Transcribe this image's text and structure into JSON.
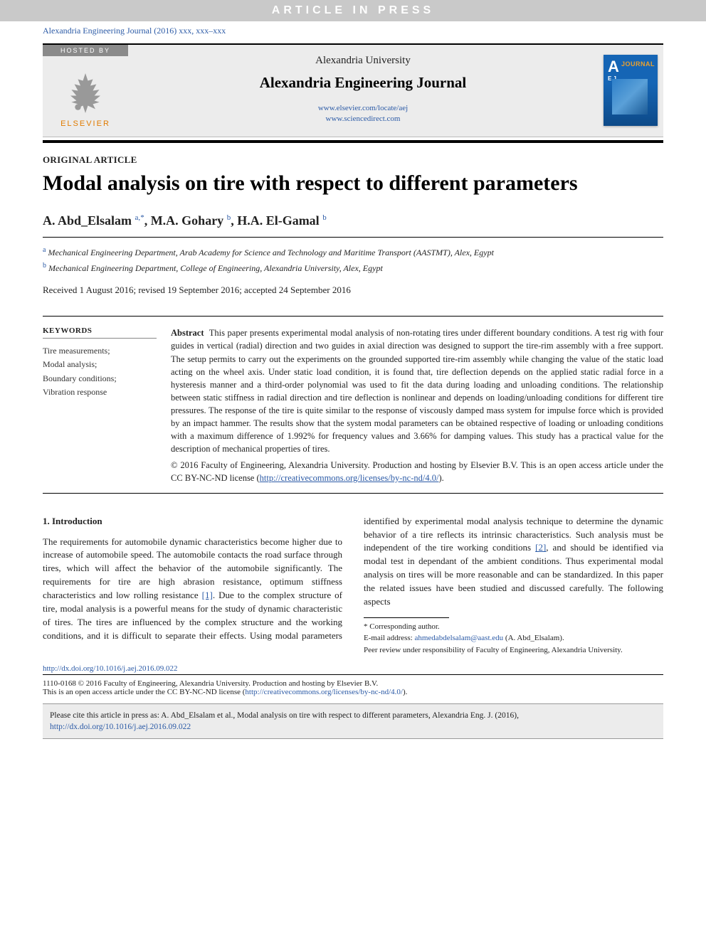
{
  "banner": "ARTICLE IN PRESS",
  "citation_top": "Alexandria Engineering Journal (2016) xxx, xxx–xxx",
  "hosted_by": "HOSTED BY",
  "publisher": "ELSEVIER",
  "university": "Alexandria University",
  "journal": "Alexandria Engineering Journal",
  "link1": "www.elsevier.com/locate/aej",
  "link2": "www.sciencedirect.com",
  "cover_letter": "A",
  "cover_sub": "E J",
  "cover_journal": "JOURNAL",
  "article_type": "ORIGINAL ARTICLE",
  "title": "Modal analysis on tire with respect to different parameters",
  "authors": {
    "a1": "A. Abd_Elsalam",
    "a1_sup": "a,",
    "a1_star": "*",
    "a2": "M.A. Gohary",
    "a2_sup": "b",
    "a3": "H.A. El-Gamal",
    "a3_sup": "b"
  },
  "affil_a_sup": "a",
  "affil_a": " Mechanical Engineering Department, Arab Academy for Science and Technology and Maritime Transport (AASTMT), Alex, Egypt",
  "affil_b_sup": "b",
  "affil_b": " Mechanical Engineering Department, College of Engineering, Alexandria University, Alex, Egypt",
  "dates": "Received 1 August 2016; revised 19 September 2016; accepted 24 September 2016",
  "kw_heading": "KEYWORDS",
  "keywords": "Tire measurements;\nModal analysis;\nBoundary conditions;\nVibration response",
  "abstract_label": "Abstract",
  "abstract": "This paper presents experimental modal analysis of non-rotating tires under different boundary conditions. A test rig with four guides in vertical (radial) direction and two guides in axial direction was designed to support the tire-rim assembly with a free support. The setup permits to carry out the experiments on the grounded supported tire-rim assembly while changing the value of the static load acting on the wheel axis. Under static load condition, it is found that, tire deflection depends on the applied static radial force in a hysteresis manner and a third-order polynomial was used to fit the data during loading and unloading conditions. The relationship between static stiffness in radial direction and tire deflection is nonlinear and depends on loading/unloading conditions for different tire pressures. The response of the tire is quite similar to the response of viscously damped mass system for impulse force which is provided by an impact hammer. The results show that the system modal parameters can be obtained respective of loading or unloading conditions with a maximum difference of 1.992% for frequency values and 3.66% for damping values. This study has a practical value for the description of mechanical properties of tires.",
  "copyright": "© 2016 Faculty of Engineering, Alexandria University. Production and hosting by Elsevier B.V. This is an open access article under the CC BY-NC-ND license (",
  "cc_url": "http://creativecommons.org/licenses/by-nc-nd/4.0/",
  "cc_close": ").",
  "section1": "1. Introduction",
  "intro_col1": "The requirements for automobile dynamic characteristics become higher due to increase of automobile speed. The automobile contacts the road surface through tires, which will affect the behavior of the automobile significantly. The requirements for tire are high abrasion resistance, optimum stiffness characteristics and low rolling resistance ",
  "ref1": "[1]",
  "intro_col1_tail": ". Due to",
  "intro_col2_a": "the complex structure of tire, modal analysis is a powerful means for the study of dynamic characteristic of tires. The tires are influenced by the complex structure and the working conditions, and it is difficult to separate their effects. Using modal parameters identified by experimental modal analysis technique to determine the dynamic behavior of a tire reflects its intrinsic characteristics. Such analysis must be independent of the tire working conditions ",
  "ref2": "[2]",
  "intro_col2_b": ", and should be identified via modal test in dependant of the ambient conditions. Thus experimental modal analysis on tires will be more reasonable and can be standardized. In this paper the related issues have been studied and discussed carefully. The following aspects",
  "fn_corr": "* Corresponding author.",
  "fn_email_label": "E-mail address: ",
  "fn_email": "ahmedabdelsalam@aast.edu",
  "fn_email_who": " (A. Abd_Elsalam).",
  "fn_peer": "Peer review under responsibility of Faculty of Engineering, Alexandria University.",
  "doi": "http://dx.doi.org/10.1016/j.aej.2016.09.022",
  "issn_line": "1110-0168 © 2016 Faculty of Engineering, Alexandria University. Production and hosting by Elsevier B.V.",
  "oa_line": "This is an open access article under the CC BY-NC-ND license (",
  "oa_url": "http://creativecommons.org/licenses/by-nc-nd/4.0/",
  "oa_close": ").",
  "cite_box_pre": "Please cite this article in press as: A. Abd_Elsalam et al., Modal analysis on tire with respect to different parameters,  Alexandria Eng. J. (2016), ",
  "cite_box_url": "http://dx.doi.org/10.1016/j.aej.2016.09.022"
}
